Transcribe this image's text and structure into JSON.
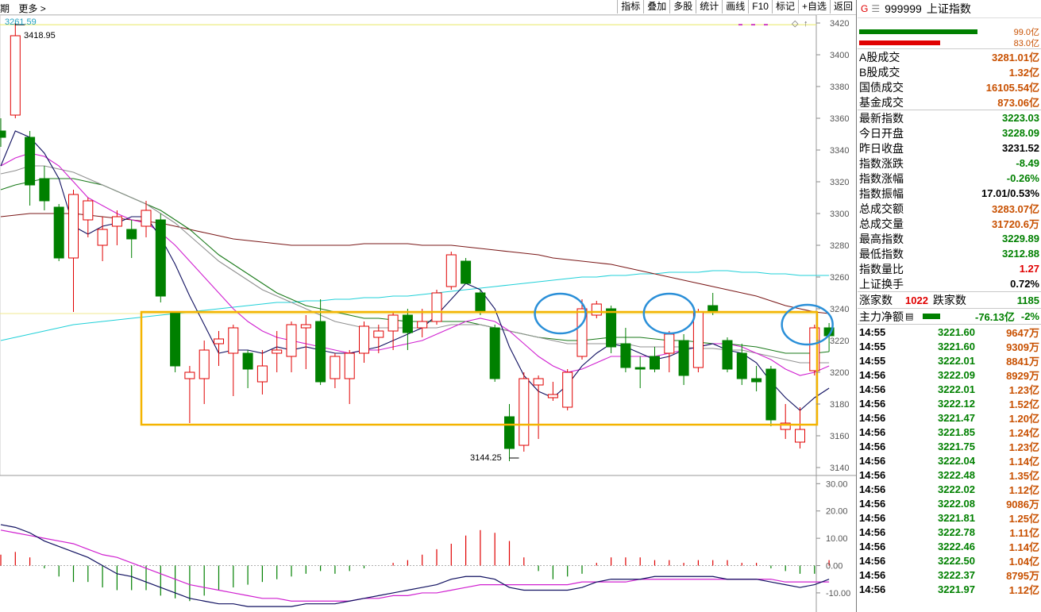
{
  "toolbar": {
    "left": [
      "期",
      "更多 >"
    ],
    "buttons": [
      "指标",
      "叠加",
      "多股",
      "统计",
      "画线",
      "F10",
      "标记",
      "+自选",
      "返回"
    ]
  },
  "chart": {
    "ma_label": "3261.59",
    "high_label": "3418.95",
    "low_label": "3144.25",
    "price_ticks": [
      "3420",
      "3400",
      "3380",
      "3360",
      "3340",
      "3320",
      "3300",
      "3280",
      "3260",
      "3240",
      "3220",
      "3200",
      "3180",
      "3160",
      "3140"
    ],
    "macd_ticks": [
      "30.00",
      "20.00",
      "10.00",
      "0.00",
      "-10.00"
    ]
  },
  "chart_data": {
    "type": "candlestick",
    "title": "",
    "ylim": [
      3135,
      3425
    ],
    "macd_ylim": [
      -17,
      33
    ],
    "candles": [
      {
        "o": 3352,
        "h": 3360,
        "l": 3342,
        "c": 3348
      },
      {
        "o": 3362,
        "h": 3420,
        "l": 3360,
        "c": 3412
      },
      {
        "o": 3348,
        "h": 3352,
        "l": 3305,
        "c": 3318
      },
      {
        "o": 3322,
        "h": 3330,
        "l": 3302,
        "c": 3308
      },
      {
        "o": 3304,
        "h": 3306,
        "l": 3270,
        "c": 3272
      },
      {
        "o": 3272,
        "h": 3315,
        "l": 3238,
        "c": 3312
      },
      {
        "o": 3296,
        "h": 3310,
        "l": 3285,
        "c": 3308
      },
      {
        "o": 3280,
        "h": 3298,
        "l": 3270,
        "c": 3290
      },
      {
        "o": 3292,
        "h": 3302,
        "l": 3280,
        "c": 3298
      },
      {
        "o": 3290,
        "h": 3296,
        "l": 3272,
        "c": 3284
      },
      {
        "o": 3292,
        "h": 3308,
        "l": 3285,
        "c": 3302
      },
      {
        "o": 3296,
        "h": 3300,
        "l": 3244,
        "c": 3248
      },
      {
        "o": 3238,
        "h": 3238,
        "l": 3200,
        "c": 3204
      },
      {
        "o": 3196,
        "h": 3204,
        "l": 3168,
        "c": 3200
      },
      {
        "o": 3196,
        "h": 3220,
        "l": 3180,
        "c": 3214
      },
      {
        "o": 3218,
        "h": 3226,
        "l": 3204,
        "c": 3221
      },
      {
        "o": 3212,
        "h": 3230,
        "l": 3185,
        "c": 3228
      },
      {
        "o": 3212,
        "h": 3214,
        "l": 3190,
        "c": 3202
      },
      {
        "o": 3194,
        "h": 3214,
        "l": 3186,
        "c": 3204
      },
      {
        "o": 3212,
        "h": 3226,
        "l": 3200,
        "c": 3214
      },
      {
        "o": 3210,
        "h": 3232,
        "l": 3200,
        "c": 3230
      },
      {
        "o": 3228,
        "h": 3236,
        "l": 3202,
        "c": 3230
      },
      {
        "o": 3232,
        "h": 3246,
        "l": 3192,
        "c": 3194
      },
      {
        "o": 3196,
        "h": 3212,
        "l": 3190,
        "c": 3210
      },
      {
        "o": 3196,
        "h": 3214,
        "l": 3180,
        "c": 3212
      },
      {
        "o": 3212,
        "h": 3232,
        "l": 3206,
        "c": 3229
      },
      {
        "o": 3222,
        "h": 3230,
        "l": 3212,
        "c": 3226
      },
      {
        "o": 3226,
        "h": 3238,
        "l": 3214,
        "c": 3236
      },
      {
        "o": 3236,
        "h": 3240,
        "l": 3214,
        "c": 3225
      },
      {
        "o": 3228,
        "h": 3240,
        "l": 3222,
        "c": 3232
      },
      {
        "o": 3232,
        "h": 3252,
        "l": 3230,
        "c": 3250
      },
      {
        "o": 3254,
        "h": 3276,
        "l": 3252,
        "c": 3274
      },
      {
        "o": 3270,
        "h": 3272,
        "l": 3256,
        "c": 3256
      },
      {
        "o": 3250,
        "h": 3252,
        "l": 3236,
        "c": 3238
      },
      {
        "o": 3228,
        "h": 3230,
        "l": 3194,
        "c": 3196
      },
      {
        "o": 3172,
        "h": 3180,
        "l": 3144,
        "c": 3152
      },
      {
        "o": 3154,
        "h": 3200,
        "l": 3150,
        "c": 3196
      },
      {
        "o": 3192,
        "h": 3198,
        "l": 3158,
        "c": 3196
      },
      {
        "o": 3184,
        "h": 3194,
        "l": 3182,
        "c": 3186
      },
      {
        "o": 3178,
        "h": 3202,
        "l": 3176,
        "c": 3200
      },
      {
        "o": 3210,
        "h": 3246,
        "l": 3208,
        "c": 3240
      },
      {
        "o": 3236,
        "h": 3245,
        "l": 3234,
        "c": 3243
      },
      {
        "o": 3240,
        "h": 3242,
        "l": 3212,
        "c": 3216
      },
      {
        "o": 3218,
        "h": 3228,
        "l": 3200,
        "c": 3203
      },
      {
        "o": 3203,
        "h": 3210,
        "l": 3190,
        "c": 3202
      },
      {
        "o": 3210,
        "h": 3216,
        "l": 3200,
        "c": 3202
      },
      {
        "o": 3212,
        "h": 3226,
        "l": 3200,
        "c": 3224
      },
      {
        "o": 3220,
        "h": 3224,
        "l": 3192,
        "c": 3198
      },
      {
        "o": 3203,
        "h": 3240,
        "l": 3200,
        "c": 3238
      },
      {
        "o": 3242,
        "h": 3250,
        "l": 3236,
        "c": 3238
      },
      {
        "o": 3220,
        "h": 3222,
        "l": 3200,
        "c": 3202
      },
      {
        "o": 3212,
        "h": 3218,
        "l": 3192,
        "c": 3196
      },
      {
        "o": 3196,
        "h": 3204,
        "l": 3188,
        "c": 3194
      },
      {
        "o": 3202,
        "h": 3204,
        "l": 3166,
        "c": 3170
      },
      {
        "o": 3164,
        "h": 3180,
        "l": 3158,
        "c": 3168
      },
      {
        "o": 3156,
        "h": 3178,
        "l": 3152,
        "c": 3164
      },
      {
        "o": 3201,
        "h": 3230,
        "l": 3198,
        "c": 3228
      },
      {
        "o": 3228,
        "h": 3231,
        "l": 3213,
        "c": 3223
      }
    ],
    "ma5": [
      3330,
      3352,
      3348,
      3338,
      3322,
      3292,
      3287,
      3292,
      3294,
      3298,
      3298,
      3285,
      3268,
      3248,
      3230,
      3212,
      3214,
      3214,
      3212,
      3216,
      3214,
      3216,
      3214,
      3212,
      3212,
      3214,
      3216,
      3220,
      3224,
      3228,
      3236,
      3246,
      3256,
      3252,
      3240,
      3216,
      3198,
      3188,
      3184,
      3192,
      3204,
      3212,
      3218,
      3216,
      3212,
      3208,
      3210,
      3214,
      3216,
      3218,
      3214,
      3212,
      3206,
      3194,
      3184,
      3176,
      3184,
      3190
    ],
    "ma10": [
      3330,
      3335,
      3338,
      3336,
      3330,
      3320,
      3310,
      3305,
      3300,
      3296,
      3294,
      3288,
      3280,
      3270,
      3260,
      3250,
      3240,
      3232,
      3226,
      3222,
      3220,
      3218,
      3216,
      3214,
      3212,
      3214,
      3214,
      3216,
      3218,
      3220,
      3224,
      3228,
      3232,
      3234,
      3232,
      3226,
      3218,
      3210,
      3204,
      3200,
      3202,
      3206,
      3210,
      3210,
      3210,
      3210,
      3212,
      3214,
      3216,
      3218,
      3218,
      3216,
      3212,
      3208,
      3202,
      3198,
      3200,
      3204
    ],
    "ma20": [
      3325,
      3327,
      3330,
      3330,
      3328,
      3326,
      3322,
      3318,
      3314,
      3310,
      3306,
      3300,
      3294,
      3286,
      3278,
      3270,
      3264,
      3258,
      3252,
      3248,
      3244,
      3240,
      3236,
      3232,
      3230,
      3228,
      3228,
      3228,
      3228,
      3228,
      3228,
      3230,
      3230,
      3230,
      3228,
      3226,
      3224,
      3222,
      3220,
      3218,
      3218,
      3218,
      3218,
      3218,
      3216,
      3216,
      3216,
      3216,
      3215,
      3215,
      3214,
      3214,
      3212,
      3210,
      3208,
      3206,
      3206,
      3206
    ],
    "ma30": [
      3315,
      3318,
      3320,
      3322,
      3322,
      3322,
      3320,
      3318,
      3314,
      3310,
      3306,
      3302,
      3296,
      3290,
      3282,
      3274,
      3268,
      3262,
      3256,
      3250,
      3246,
      3242,
      3240,
      3238,
      3236,
      3234,
      3234,
      3233,
      3232,
      3232,
      3232,
      3232,
      3232,
      3230,
      3228,
      3226,
      3224,
      3222,
      3221,
      3220,
      3220,
      3221,
      3222,
      3222,
      3222,
      3221,
      3220,
      3220,
      3219,
      3218,
      3218,
      3217,
      3216,
      3214,
      3212,
      3212,
      3212,
      3213
    ],
    "ma60": [
      3298,
      3299,
      3300,
      3300,
      3300,
      3300,
      3299,
      3298,
      3297,
      3296,
      3295,
      3294,
      3292,
      3290,
      3288,
      3286,
      3284,
      3283,
      3282,
      3281,
      3280,
      3280,
      3280,
      3280,
      3280,
      3281,
      3281,
      3281,
      3281,
      3280,
      3280,
      3280,
      3279,
      3278,
      3277,
      3276,
      3275,
      3274,
      3272,
      3271,
      3270,
      3269,
      3268,
      3266,
      3264,
      3262,
      3260,
      3258,
      3256,
      3254,
      3252,
      3250,
      3248,
      3245,
      3242,
      3240,
      3238,
      3237
    ],
    "ma120": [
      3220,
      3222,
      3224,
      3226,
      3228,
      3230,
      3231,
      3232,
      3233,
      3234,
      3235,
      3236,
      3237,
      3238,
      3239,
      3240,
      3241,
      3242,
      3243,
      3244,
      3244,
      3245,
      3245,
      3246,
      3246,
      3247,
      3247,
      3248,
      3248,
      3249,
      3250,
      3251,
      3252,
      3253,
      3254,
      3255,
      3256,
      3257,
      3258,
      3259,
      3260,
      3260,
      3261,
      3261,
      3262,
      3262,
      3263,
      3263,
      3263,
      3264,
      3264,
      3263,
      3263,
      3262,
      3262,
      3261,
      3261,
      3261
    ],
    "macd_dif": [
      15,
      14,
      12,
      9,
      7,
      5,
      3,
      0,
      -3,
      -4,
      -6,
      -8,
      -10,
      -12,
      -13,
      -14,
      -14,
      -15,
      -15,
      -15,
      -15,
      -14,
      -14,
      -14,
      -13,
      -12,
      -11,
      -10,
      -9,
      -8,
      -7,
      -5,
      -4,
      -4,
      -5,
      -8,
      -9,
      -9,
      -9,
      -9,
      -8,
      -6,
      -5,
      -5,
      -5,
      -4,
      -4,
      -4,
      -4,
      -4,
      -5,
      -5,
      -5,
      -6,
      -7,
      -8,
      -7,
      -5
    ],
    "macd_dea": [
      13,
      12,
      11,
      10,
      9,
      8,
      6,
      4,
      3,
      1,
      -1,
      -3,
      -5,
      -7,
      -8,
      -9,
      -10,
      -11,
      -12,
      -12,
      -13,
      -13,
      -13,
      -13,
      -13,
      -12,
      -12,
      -11,
      -11,
      -10,
      -10,
      -9,
      -8,
      -7,
      -7,
      -7,
      -7,
      -7,
      -7,
      -7,
      -6,
      -6,
      -6,
      -6,
      -5,
      -5,
      -5,
      -5,
      -5,
      -5,
      -5,
      -5,
      -5,
      -5,
      -6,
      -6,
      -6,
      -6
    ],
    "macd_hist": [
      4,
      5,
      3,
      -1,
      -4,
      -6,
      -6,
      -8,
      -9,
      -9,
      -9,
      -11,
      -12,
      -13,
      -11,
      -9,
      -8,
      -7,
      -6,
      -5,
      -4,
      -3,
      -2,
      -3,
      -2,
      -1,
      0,
      1,
      2,
      4,
      6,
      8,
      11,
      13,
      12,
      9,
      3,
      -2,
      -5,
      -4,
      -3,
      1,
      3,
      3,
      3,
      2,
      2,
      1,
      2,
      2,
      2,
      1,
      1,
      -1,
      -2,
      -3,
      -3,
      2
    ]
  },
  "header": {
    "market": "G",
    "code": "999999",
    "name": "上证指数"
  },
  "ratio": {
    "top_value": "99.0亿",
    "bottom_value": "83.0亿",
    "top_fraction": 0.66,
    "bottom_fraction": 0.45
  },
  "turnover": [
    {
      "label": "A股成交",
      "value": "3281.01亿"
    },
    {
      "label": "B股成交",
      "value": "1.32亿"
    },
    {
      "label": "国债成交",
      "value": "16105.54亿"
    },
    {
      "label": "基金成交",
      "value": "873.06亿"
    }
  ],
  "quote": [
    {
      "label": "最新指数",
      "value": "3223.03",
      "color": "#008000"
    },
    {
      "label": "今日开盘",
      "value": "3228.09",
      "color": "#008000"
    },
    {
      "label": "昨日收盘",
      "value": "3231.52",
      "color": "#000000"
    },
    {
      "label": "指数涨跌",
      "value": "-8.49",
      "color": "#008000"
    },
    {
      "label": "指数涨幅",
      "value": "-0.26%",
      "color": "#008000"
    },
    {
      "label": "指数振幅",
      "value": "17.01/0.53%",
      "color": "#000000"
    },
    {
      "label": "总成交额",
      "value": "3283.07亿",
      "color": "#c85000"
    },
    {
      "label": "总成交量",
      "value": "31720.6万",
      "color": "#c85000"
    },
    {
      "label": "最高指数",
      "value": "3229.89",
      "color": "#008000"
    },
    {
      "label": "最低指数",
      "value": "3212.88",
      "color": "#008000"
    },
    {
      "label": "指数量比",
      "value": "1.27",
      "color": "#e00000"
    },
    {
      "label": "上证换手",
      "value": "0.72%",
      "color": "#000000"
    }
  ],
  "updown": {
    "up_label": "涨家数",
    "up_value": "1022",
    "down_label": "跌家数",
    "down_value": "1185"
  },
  "flow": {
    "label": "主力净额",
    "value": "-76.13亿",
    "pct": "-2%"
  },
  "ticks": [
    {
      "time": "14:55",
      "price": "3221.60",
      "vol": "9647万"
    },
    {
      "time": "14:55",
      "price": "3221.60",
      "vol": "9309万"
    },
    {
      "time": "14:55",
      "price": "3222.01",
      "vol": "8841万"
    },
    {
      "time": "14:56",
      "price": "3222.09",
      "vol": "8929万"
    },
    {
      "time": "14:56",
      "price": "3222.01",
      "vol": "1.23亿"
    },
    {
      "time": "14:56",
      "price": "3222.12",
      "vol": "1.52亿"
    },
    {
      "time": "14:56",
      "price": "3221.47",
      "vol": "1.20亿"
    },
    {
      "time": "14:56",
      "price": "3221.85",
      "vol": "1.24亿"
    },
    {
      "time": "14:56",
      "price": "3221.75",
      "vol": "1.23亿"
    },
    {
      "time": "14:56",
      "price": "3222.04",
      "vol": "1.14亿"
    },
    {
      "time": "14:56",
      "price": "3222.48",
      "vol": "1.35亿"
    },
    {
      "time": "14:56",
      "price": "3222.02",
      "vol": "1.12亿"
    },
    {
      "time": "14:56",
      "price": "3222.08",
      "vol": "9086万"
    },
    {
      "time": "14:56",
      "price": "3221.81",
      "vol": "1.25亿"
    },
    {
      "time": "14:56",
      "price": "3222.78",
      "vol": "1.11亿"
    },
    {
      "time": "14:56",
      "price": "3222.46",
      "vol": "1.14亿"
    },
    {
      "time": "14:56",
      "price": "3222.50",
      "vol": "1.04亿"
    },
    {
      "time": "14:56",
      "price": "3222.37",
      "vol": "8795万"
    },
    {
      "time": "14:56",
      "price": "3221.97",
      "vol": "1.12亿"
    }
  ],
  "colors": {
    "up": "#e00000",
    "down": "#008000",
    "box": "#f4b400",
    "circle": "#2a8fd8"
  }
}
